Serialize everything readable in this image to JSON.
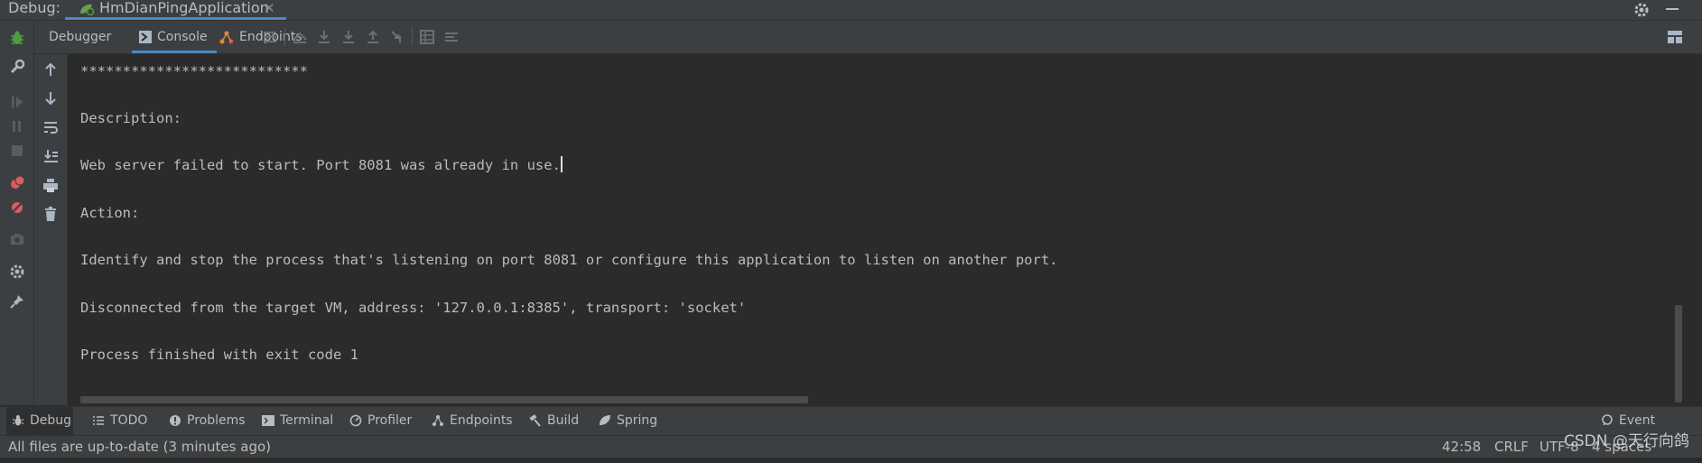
{
  "titlebar": {
    "debug_label": "Debug:",
    "run_config": "HmDianPingApplication",
    "close_glyph": "✕",
    "icons": [
      "spring-run-icon",
      "gear-icon",
      "minimize-icon"
    ]
  },
  "debug_toolbar": {
    "tabs": [
      {
        "label": "Debugger"
      },
      {
        "label": "Console",
        "active": true
      },
      {
        "label": "Endpoints"
      }
    ],
    "buttons": [
      "menu-icon",
      "show-execution-point-icon",
      "step-over-icon",
      "step-into-icon",
      "step-out-icon",
      "run-to-cursor-icon",
      "evaluate-icon",
      "trace-icon",
      "layout-icon"
    ]
  },
  "left_toolbar": [
    "debug-bug-icon",
    "wrench-icon",
    "resume-icon",
    "pause-icon",
    "stop-icon",
    "view-breakpoints-icon",
    "mute-breakpoints-icon",
    "camera-icon",
    "settings-icon",
    "pin-icon"
  ],
  "console_toolbar": [
    "up-arrow-icon",
    "down-arrow-icon",
    "soft-wrap-icon",
    "scroll-to-end-icon",
    "print-icon",
    "clear-icon"
  ],
  "console": {
    "lines": [
      "***************************",
      "Description:",
      "Web server failed to start. Port 8081 was already in use.",
      "Action:",
      "Identify and stop the process that's listening on port 8081 or configure this application to listen on another port.",
      "Disconnected from the target VM, address: '127.0.0.1:8385', transport: 'socket'",
      "Process finished with exit code 1"
    ]
  },
  "bottom_tabs": [
    {
      "label": "Debug",
      "icon": "bug-icon",
      "active": true
    },
    {
      "label": "TODO",
      "icon": "list-icon"
    },
    {
      "label": "Problems",
      "icon": "info-icon"
    },
    {
      "label": "Terminal",
      "icon": "terminal-icon"
    },
    {
      "label": "Profiler",
      "icon": "profiler-icon"
    },
    {
      "label": "Endpoints",
      "icon": "endpoints-icon"
    },
    {
      "label": "Build",
      "icon": "hammer-icon"
    },
    {
      "label": "Spring",
      "icon": "spring-leaf-icon"
    }
  ],
  "event_log": "Event Log",
  "status": {
    "message": "All files are up-to-date (3 minutes ago)",
    "position": "42:58",
    "line_sep": "CRLF",
    "encoding": "UTF-8",
    "indent": "4 spaces"
  },
  "watermark": "CSDN @天行向鸽",
  "colors": {
    "accent": "#4a88c7",
    "background": "#2b2b2b",
    "panel": "#3c3f41",
    "text": "#bbbbbb",
    "debug_green": "#4d9f3f",
    "breakpoint_red": "#db5c5c"
  }
}
